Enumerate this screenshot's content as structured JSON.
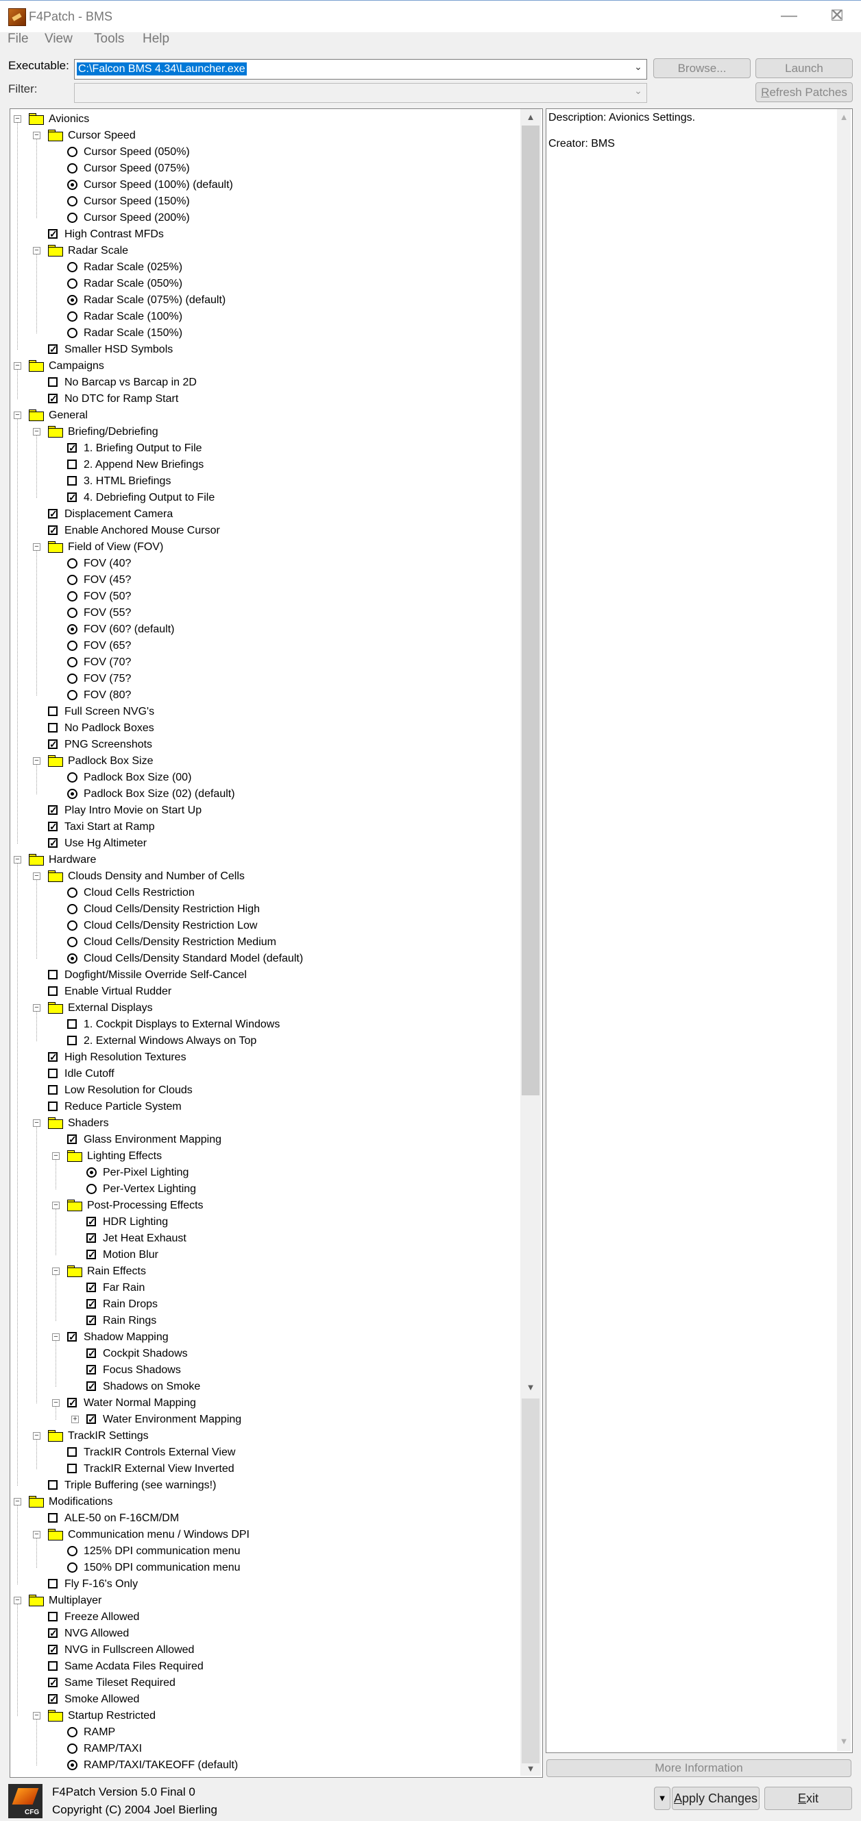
{
  "window": {
    "title": "F4Patch - BMS",
    "minimize": "—",
    "maximize": "☐",
    "close": "✕"
  },
  "menu": [
    "File",
    "View",
    "Tools",
    "Help"
  ],
  "executable": {
    "label": "Executable:",
    "value": "C:\\Falcon BMS 4.34\\Launcher.exe",
    "browse": "Browse...",
    "launch": "Launch"
  },
  "filter": {
    "label": "Filter:",
    "value": "",
    "refresh_prefix": "R",
    "refresh_rest": "efresh Patches"
  },
  "tree": [
    {
      "level": 0,
      "kind": "folder",
      "text": "Avionics",
      "toggle": "minus"
    },
    {
      "level": 1,
      "kind": "folder",
      "text": "Cursor Speed",
      "toggle": "minus"
    },
    {
      "level": 2,
      "kind": "radio",
      "text": "Cursor Speed (050%)",
      "checked": false
    },
    {
      "level": 2,
      "kind": "radio",
      "text": "Cursor Speed (075%)",
      "checked": false
    },
    {
      "level": 2,
      "kind": "radio",
      "text": "Cursor Speed (100%) (default)",
      "checked": true
    },
    {
      "level": 2,
      "kind": "radio",
      "text": "Cursor Speed (150%)",
      "checked": false
    },
    {
      "level": 2,
      "kind": "radio",
      "text": "Cursor Speed (200%)",
      "checked": false
    },
    {
      "level": 1,
      "kind": "check",
      "text": "High Contrast MFDs",
      "checked": true
    },
    {
      "level": 1,
      "kind": "folder",
      "text": "Radar Scale",
      "toggle": "minus"
    },
    {
      "level": 2,
      "kind": "radio",
      "text": "Radar Scale (025%)",
      "checked": false
    },
    {
      "level": 2,
      "kind": "radio",
      "text": "Radar Scale (050%)",
      "checked": false
    },
    {
      "level": 2,
      "kind": "radio",
      "text": "Radar Scale (075%) (default)",
      "checked": true
    },
    {
      "level": 2,
      "kind": "radio",
      "text": "Radar Scale (100%)",
      "checked": false
    },
    {
      "level": 2,
      "kind": "radio",
      "text": "Radar Scale (150%)",
      "checked": false
    },
    {
      "level": 1,
      "kind": "check",
      "text": "Smaller HSD Symbols",
      "checked": true
    },
    {
      "level": 0,
      "kind": "folder",
      "text": "Campaigns",
      "toggle": "minus"
    },
    {
      "level": 1,
      "kind": "check",
      "text": "No Barcap vs Barcap in 2D",
      "checked": false
    },
    {
      "level": 1,
      "kind": "check",
      "text": "No DTC for Ramp Start",
      "checked": true
    },
    {
      "level": 0,
      "kind": "folder",
      "text": "General",
      "toggle": "minus"
    },
    {
      "level": 1,
      "kind": "folder",
      "text": "Briefing/Debriefing",
      "toggle": "minus"
    },
    {
      "level": 2,
      "kind": "check",
      "text": "1. Briefing Output to File",
      "checked": true
    },
    {
      "level": 2,
      "kind": "check",
      "text": "2. Append New Briefings",
      "checked": false
    },
    {
      "level": 2,
      "kind": "check",
      "text": "3. HTML Briefings",
      "checked": false
    },
    {
      "level": 2,
      "kind": "check",
      "text": "4. Debriefing Output to File",
      "checked": true
    },
    {
      "level": 1,
      "kind": "check",
      "text": "Displacement Camera",
      "checked": true
    },
    {
      "level": 1,
      "kind": "check",
      "text": "Enable Anchored Mouse Cursor",
      "checked": true
    },
    {
      "level": 1,
      "kind": "folder",
      "text": "Field of View (FOV)",
      "toggle": "minus"
    },
    {
      "level": 2,
      "kind": "radio",
      "text": "FOV (40?",
      "checked": false
    },
    {
      "level": 2,
      "kind": "radio",
      "text": "FOV (45?",
      "checked": false
    },
    {
      "level": 2,
      "kind": "radio",
      "text": "FOV (50?",
      "checked": false
    },
    {
      "level": 2,
      "kind": "radio",
      "text": "FOV (55?",
      "checked": false
    },
    {
      "level": 2,
      "kind": "radio",
      "text": "FOV (60? (default)",
      "checked": true
    },
    {
      "level": 2,
      "kind": "radio",
      "text": "FOV (65?",
      "checked": false
    },
    {
      "level": 2,
      "kind": "radio",
      "text": "FOV (70?",
      "checked": false
    },
    {
      "level": 2,
      "kind": "radio",
      "text": "FOV (75?",
      "checked": false
    },
    {
      "level": 2,
      "kind": "radio",
      "text": "FOV (80?",
      "checked": false
    },
    {
      "level": 1,
      "kind": "check",
      "text": "Full Screen NVG's",
      "checked": false
    },
    {
      "level": 1,
      "kind": "check",
      "text": "No Padlock Boxes",
      "checked": false
    },
    {
      "level": 1,
      "kind": "check",
      "text": "PNG Screenshots",
      "checked": true
    },
    {
      "level": 1,
      "kind": "folder",
      "text": "Padlock Box Size",
      "toggle": "minus"
    },
    {
      "level": 2,
      "kind": "radio",
      "text": "Padlock Box Size (00)",
      "checked": false
    },
    {
      "level": 2,
      "kind": "radio",
      "text": "Padlock Box Size (02) (default)",
      "checked": true
    },
    {
      "level": 1,
      "kind": "check",
      "text": "Play Intro Movie on Start Up",
      "checked": true
    },
    {
      "level": 1,
      "kind": "check",
      "text": "Taxi Start at Ramp",
      "checked": true
    },
    {
      "level": 1,
      "kind": "check",
      "text": "Use Hg Altimeter",
      "checked": true
    },
    {
      "level": 0,
      "kind": "folder",
      "text": "Hardware",
      "toggle": "minus"
    },
    {
      "level": 1,
      "kind": "folder",
      "text": "Clouds Density and Number of Cells",
      "toggle": "minus"
    },
    {
      "level": 2,
      "kind": "radio",
      "text": "Cloud Cells Restriction",
      "checked": false
    },
    {
      "level": 2,
      "kind": "radio",
      "text": "Cloud Cells/Density Restriction High",
      "checked": false
    },
    {
      "level": 2,
      "kind": "radio",
      "text": "Cloud Cells/Density Restriction Low",
      "checked": false
    },
    {
      "level": 2,
      "kind": "radio",
      "text": "Cloud Cells/Density Restriction Medium",
      "checked": false
    },
    {
      "level": 2,
      "kind": "radio",
      "text": "Cloud Cells/Density Standard Model (default)",
      "checked": true
    },
    {
      "level": 1,
      "kind": "check",
      "text": "Dogfight/Missile Override Self-Cancel",
      "checked": false
    },
    {
      "level": 1,
      "kind": "check",
      "text": "Enable Virtual Rudder",
      "checked": false
    },
    {
      "level": 1,
      "kind": "folder",
      "text": "External Displays",
      "toggle": "minus"
    },
    {
      "level": 2,
      "kind": "check",
      "text": "1. Cockpit Displays to External Windows",
      "checked": false
    },
    {
      "level": 2,
      "kind": "check",
      "text": "2. External Windows Always on Top",
      "checked": false
    },
    {
      "level": 1,
      "kind": "check",
      "text": "High Resolution Textures",
      "checked": true
    },
    {
      "level": 1,
      "kind": "check",
      "text": "Idle Cutoff",
      "checked": false
    },
    {
      "level": 1,
      "kind": "check",
      "text": "Low Resolution for Clouds",
      "checked": false
    },
    {
      "level": 1,
      "kind": "check",
      "text": "Reduce Particle System",
      "checked": false
    },
    {
      "level": 1,
      "kind": "folder",
      "text": "Shaders",
      "toggle": "minus"
    },
    {
      "level": 2,
      "kind": "check",
      "text": "Glass Environment Mapping",
      "checked": true
    },
    {
      "level": 2,
      "kind": "folder",
      "text": "Lighting Effects",
      "toggle": "minus"
    },
    {
      "level": 3,
      "kind": "radio",
      "text": "Per-Pixel Lighting",
      "checked": true
    },
    {
      "level": 3,
      "kind": "radio",
      "text": "Per-Vertex Lighting",
      "checked": false
    },
    {
      "level": 2,
      "kind": "folder",
      "text": "Post-Processing Effects",
      "toggle": "minus"
    },
    {
      "level": 3,
      "kind": "check",
      "text": "HDR Lighting",
      "checked": true
    },
    {
      "level": 3,
      "kind": "check",
      "text": "Jet Heat Exhaust",
      "checked": true
    },
    {
      "level": 3,
      "kind": "check",
      "text": "Motion Blur",
      "checked": true
    },
    {
      "level": 2,
      "kind": "folder",
      "text": "Rain Effects",
      "toggle": "minus"
    },
    {
      "level": 3,
      "kind": "check",
      "text": "Far Rain",
      "checked": true
    },
    {
      "level": 3,
      "kind": "check",
      "text": "Rain Drops",
      "checked": true
    },
    {
      "level": 3,
      "kind": "check",
      "text": "Rain Rings",
      "checked": true
    },
    {
      "level": 2,
      "kind": "check",
      "text": "Shadow Mapping",
      "checked": true,
      "toggle": "minus"
    },
    {
      "level": 3,
      "kind": "check",
      "text": "Cockpit Shadows",
      "checked": true
    },
    {
      "level": 3,
      "kind": "check",
      "text": "Focus Shadows",
      "checked": true
    },
    {
      "level": 3,
      "kind": "check",
      "text": "Shadows on Smoke",
      "checked": true
    },
    {
      "level": 2,
      "kind": "check",
      "text": "Water Normal Mapping",
      "checked": true,
      "toggle": "minus"
    },
    {
      "level": 3,
      "kind": "check",
      "text": "Water Environment Mapping",
      "checked": true,
      "toggle": "plus"
    },
    {
      "level": 1,
      "kind": "folder",
      "text": "TrackIR Settings",
      "toggle": "minus"
    },
    {
      "level": 2,
      "kind": "check",
      "text": "TrackIR Controls External View",
      "checked": false
    },
    {
      "level": 2,
      "kind": "check",
      "text": "TrackIR External View Inverted",
      "checked": false
    },
    {
      "level": 1,
      "kind": "check",
      "text": "Triple Buffering (see warnings!)",
      "checked": false
    },
    {
      "level": 0,
      "kind": "folder",
      "text": "Modifications",
      "toggle": "minus"
    },
    {
      "level": 1,
      "kind": "check",
      "text": "ALE-50 on F-16CM/DM",
      "checked": false
    },
    {
      "level": 1,
      "kind": "folder",
      "text": "Communication menu / Windows DPI",
      "toggle": "minus"
    },
    {
      "level": 2,
      "kind": "radio",
      "text": "125% DPI communication menu",
      "checked": false
    },
    {
      "level": 2,
      "kind": "radio",
      "text": "150% DPI communication menu",
      "checked": false
    },
    {
      "level": 1,
      "kind": "check",
      "text": "Fly F-16's Only",
      "checked": false
    },
    {
      "level": 0,
      "kind": "folder",
      "text": "Multiplayer",
      "toggle": "minus"
    },
    {
      "level": 1,
      "kind": "check",
      "text": "Freeze Allowed",
      "checked": false
    },
    {
      "level": 1,
      "kind": "check",
      "text": "NVG Allowed",
      "checked": true
    },
    {
      "level": 1,
      "kind": "check",
      "text": "NVG in Fullscreen Allowed",
      "checked": true
    },
    {
      "level": 1,
      "kind": "check",
      "text": "Same Acdata Files Required",
      "checked": false
    },
    {
      "level": 1,
      "kind": "check",
      "text": "Same Tileset Required",
      "checked": true
    },
    {
      "level": 1,
      "kind": "check",
      "text": "Smoke Allowed",
      "checked": true
    },
    {
      "level": 1,
      "kind": "folder",
      "text": "Startup Restricted",
      "toggle": "minus"
    },
    {
      "level": 2,
      "kind": "radio",
      "text": "RAMP",
      "checked": false
    },
    {
      "level": 2,
      "kind": "radio",
      "text": "RAMP/TAXI",
      "checked": false
    },
    {
      "level": 2,
      "kind": "radio",
      "text": "RAMP/TAXI/TAKEOFF (default)",
      "checked": true
    }
  ],
  "description": {
    "line1": "Description: Avionics Settings.",
    "line2": "Creator: BMS",
    "more_info": "More Information"
  },
  "status": {
    "version": "F4Patch Version  5.0 Final 0",
    "copyright": "Copyright (C) 2004 Joel Bierling",
    "logo_text": "CFG"
  },
  "actions": {
    "apply_prefix": "A",
    "apply_rest": "pply Changes",
    "exit_prefix": "E",
    "exit_rest": "xit"
  },
  "glyphs": {
    "scroll_up": "▲",
    "scroll_down": "▼",
    "combo_arrow": "⌄",
    "check_mark": "✓",
    "minus": "−",
    "plus": "+"
  }
}
